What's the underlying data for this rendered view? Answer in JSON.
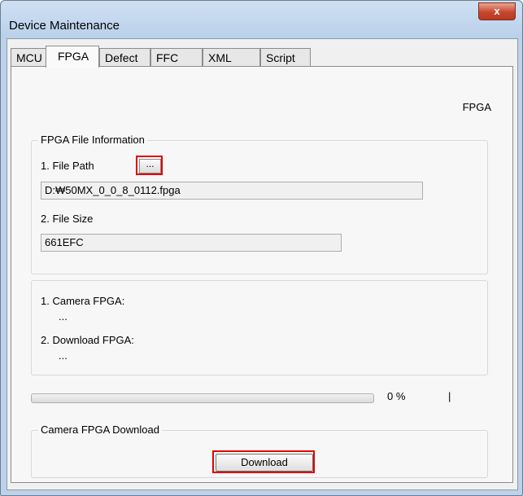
{
  "window": {
    "title": "Device Maintenance",
    "close_glyph": "x"
  },
  "tabs": [
    {
      "label": "MCU"
    },
    {
      "label": "FPGA"
    },
    {
      "label": "Defect"
    },
    {
      "label": "FFC"
    },
    {
      "label": "XML"
    },
    {
      "label": "Script"
    }
  ],
  "active_tab": "FPGA",
  "panel": {
    "section_label": "FPGA",
    "file_info": {
      "legend": "FPGA File Information",
      "file_path_label": "1. File Path",
      "browse_label": "...",
      "file_path_value": "D:₩50MX_0_0_8_0112.fpga",
      "file_size_label": "2. File Size",
      "file_size_value": "661EFC"
    },
    "versions": {
      "camera_label": "1. Camera FPGA:",
      "camera_value": "...",
      "download_label": "2. Download FPGA:",
      "download_value": "..."
    },
    "progress": {
      "percent_text": "0 %",
      "value": 0,
      "indicator": "|"
    },
    "download_group": {
      "legend": "Camera FPGA Download",
      "button_label": "Download"
    }
  }
}
